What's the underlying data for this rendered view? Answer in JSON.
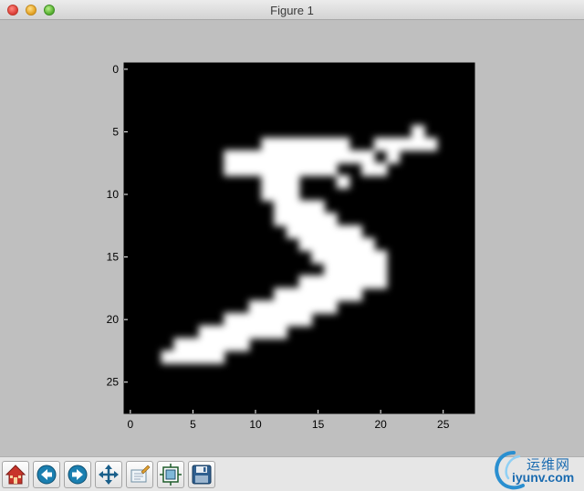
{
  "window": {
    "title": "Figure 1"
  },
  "toolbar": {
    "buttons": [
      {
        "name": "home-button",
        "icon": "home-icon"
      },
      {
        "name": "back-button",
        "icon": "back-arrow-icon"
      },
      {
        "name": "forward-button",
        "icon": "forward-arrow-icon"
      },
      {
        "name": "pan-button",
        "icon": "pan-arrows-icon"
      },
      {
        "name": "zoom-rect-button",
        "icon": "zoom-rect-icon"
      },
      {
        "name": "subplots-button",
        "icon": "subplots-icon"
      },
      {
        "name": "save-button",
        "icon": "save-disk-icon"
      }
    ]
  },
  "watermark": {
    "cn": "运维网",
    "en": "iyunv.com"
  },
  "chart_data": {
    "type": "heatmap",
    "title": "",
    "xlabel": "",
    "ylabel": "",
    "colormap": "gray",
    "xlim": [
      -0.5,
      27.5
    ],
    "ylim": [
      27.5,
      -0.5
    ],
    "x_ticks": [
      0,
      5,
      10,
      15,
      20,
      25
    ],
    "y_ticks": [
      0,
      5,
      10,
      15,
      20,
      25
    ],
    "x_tick_labels": [
      "0",
      "5",
      "10",
      "15",
      "20",
      "25"
    ],
    "y_tick_labels": [
      "0",
      "5",
      "10",
      "15",
      "20",
      "25"
    ],
    "image_rows": [
      "............................",
      "............................",
      "............................",
      "............................",
      "............................",
      ".......................#....",
      "...........#######..#####...",
      "........############.#......",
      "........#########..##.......",
      "...........###...#..........",
      "...........###..............",
      "............####............",
      "............#####...........",
      ".............######.........",
      "..............######........",
      "...............######.......",
      "................#####.......",
      "..............#######.......",
      "............#######.........",
      "..........#######...........",
      "........#######.............",
      "......#######...............",
      "....######..................",
      "...#####....................",
      "............................",
      "............................",
      "............................",
      "............................"
    ]
  }
}
